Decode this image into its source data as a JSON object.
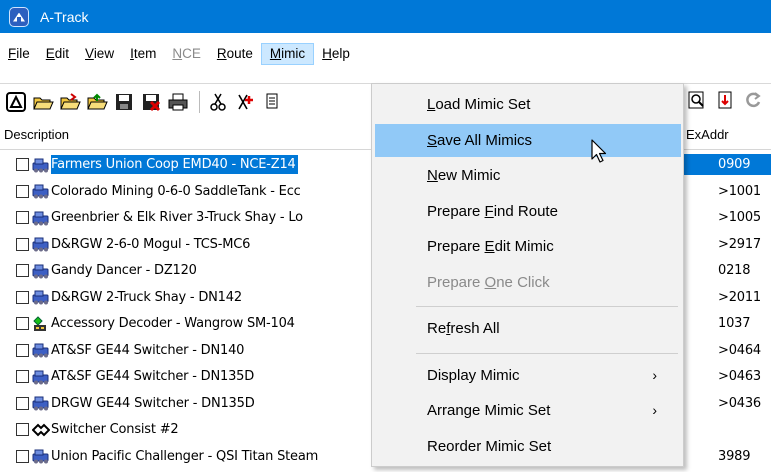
{
  "window": {
    "title": "A-Track"
  },
  "menubar": [
    {
      "label": "File",
      "ul": "F",
      "rest": "ile",
      "disabled": false,
      "active": false
    },
    {
      "label": "Edit",
      "ul": "E",
      "rest": "dit",
      "disabled": false,
      "active": false
    },
    {
      "label": "View",
      "ul": "V",
      "rest": "iew",
      "disabled": false,
      "active": false
    },
    {
      "label": "Item",
      "ul": "I",
      "rest": "tem",
      "disabled": false,
      "active": false
    },
    {
      "label": "NCE",
      "ul": "N",
      "rest": "CE",
      "disabled": true,
      "active": false
    },
    {
      "label": "Route",
      "ul": "R",
      "rest": "oute",
      "disabled": false,
      "active": false
    },
    {
      "label": "Mimic",
      "ul": "M",
      "rest": "imic",
      "disabled": false,
      "active": true
    },
    {
      "label": "Help",
      "ul": "H",
      "rest": "elp",
      "disabled": false,
      "active": false
    }
  ],
  "list": {
    "col_description": "Description",
    "col_exaddr": "ExAddr",
    "rows": [
      {
        "text": "Farmers Union Coop EMD40 - NCE-Z14",
        "addr": "0909",
        "mid": "",
        "selected": true,
        "icon": "locomotive-icon"
      },
      {
        "text": "Colorado Mining 0-6-0 SaddleTank - Ecc",
        "addr": ">1001",
        "mid": "",
        "selected": false,
        "icon": "locomotive-icon"
      },
      {
        "text": "Greenbrier & Elk River 3-Truck Shay - Lo",
        "addr": ">1005",
        "mid": "",
        "selected": false,
        "icon": "locomotive-icon"
      },
      {
        "text": "D&RGW 2-6-0 Mogul - TCS-MC6",
        "addr": ">2917",
        "mid": "",
        "selected": false,
        "icon": "locomotive-icon"
      },
      {
        "text": "Gandy Dancer - DZ120",
        "addr": "0218",
        "mid": "",
        "selected": false,
        "icon": "locomotive-icon"
      },
      {
        "text": "D&RGW 2-Truck Shay - DN142",
        "addr": ">2011",
        "mid": "",
        "selected": false,
        "icon": "locomotive-icon"
      },
      {
        "text": "Accessory Decoder - Wangrow SM-104",
        "addr": "1037",
        "mid": "",
        "selected": false,
        "icon": "accessory-icon"
      },
      {
        "text": "AT&SF GE44 Switcher - DN140",
        "addr": ">0464",
        "mid": "",
        "selected": false,
        "icon": "locomotive-icon"
      },
      {
        "text": "AT&SF GE44 Switcher - DN135D",
        "addr": ">0463",
        "mid": "",
        "selected": false,
        "icon": "locomotive-icon"
      },
      {
        "text": "DRGW GE44 Switcher - DN135D",
        "addr": ">0436",
        "mid": "",
        "selected": false,
        "icon": "locomotive-icon"
      },
      {
        "text": "Switcher Consist #2",
        "addr": "",
        "mid": "",
        "selected": false,
        "icon": "consist-icon"
      },
      {
        "text": "Union Pacific Challenger - QSI Titan Steam",
        "addr": "3989",
        "mid": "",
        "selected": false,
        "icon": "locomotive-icon"
      }
    ]
  },
  "mimic_menu": {
    "items": [
      {
        "pre": "",
        "ul": "L",
        "post": "oad Mimic Set",
        "disabled": false,
        "hover": false,
        "submenu": false
      },
      {
        "pre": "",
        "ul": "S",
        "post": "ave All Mimics",
        "disabled": false,
        "hover": true,
        "submenu": false
      },
      {
        "pre": "",
        "ul": "N",
        "post": "ew Mimic",
        "disabled": false,
        "hover": false,
        "submenu": false
      },
      {
        "pre": "Prepare ",
        "ul": "F",
        "post": "ind Route",
        "disabled": false,
        "hover": false,
        "submenu": false
      },
      {
        "pre": "Prepare ",
        "ul": "E",
        "post": "dit Mimic",
        "disabled": false,
        "hover": false,
        "submenu": false
      },
      {
        "pre": "Prepare ",
        "ul": "O",
        "post": "ne Click",
        "disabled": true,
        "hover": false,
        "submenu": false
      },
      {
        "pre": "Re",
        "ul": "f",
        "post": "resh All",
        "disabled": false,
        "hover": false,
        "submenu": false,
        "sep_before": true
      },
      {
        "pre": "Display Mimic",
        "ul": "",
        "post": "",
        "disabled": false,
        "hover": false,
        "submenu": true,
        "sep_before": true
      },
      {
        "pre": "Arrange Mimic Set",
        "ul": "",
        "post": "",
        "disabled": false,
        "hover": false,
        "submenu": true
      },
      {
        "pre": "Reorder Mimic Set",
        "ul": "",
        "post": "",
        "disabled": false,
        "hover": false,
        "submenu": false
      }
    ]
  },
  "colors": {
    "titlebar": "#0078d7",
    "selection": "#0078d7",
    "menu_hover": "#91c9f7"
  }
}
